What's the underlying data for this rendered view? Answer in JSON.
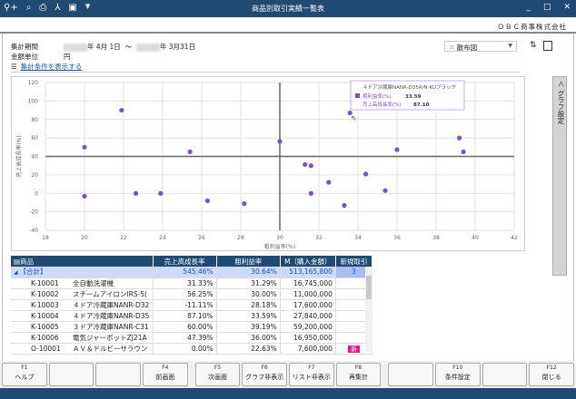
{
  "window": {
    "title": "商品別取引実績一覧表",
    "toolbar_icons": [
      "zoom-in-icon",
      "search-doc-icon",
      "print-icon",
      "pdf-icon",
      "excel-icon",
      "dropdown-icon"
    ]
  },
  "company": "ＯＢＣ商事株式会社",
  "conditions": {
    "period_label": "集計期間",
    "period_start": "年 4月 1日",
    "period_sep": "～",
    "period_end": "年 3月31日",
    "unit_label": "金額単位",
    "unit_value": "円",
    "show_conditions_link": "集計条件を表示する"
  },
  "chart_type_select": "散布図",
  "side_panel": "グラフ設定",
  "chart_data": {
    "type": "scatter",
    "xlabel": "粗利益率(%)",
    "ylabel": "売上高成長率(%)",
    "xlim": [
      18,
      42
    ],
    "ylim": [
      -40,
      120
    ],
    "xticks": [
      18,
      20,
      22,
      24,
      26,
      28,
      30,
      32,
      34,
      36,
      38,
      40,
      42
    ],
    "yticks": [
      -40,
      -20,
      0,
      20,
      40,
      60,
      80,
      100,
      120
    ],
    "grid": true,
    "quadrant_lines": {
      "x": 30,
      "y": 40
    },
    "color": "#7e4fc6",
    "points": [
      {
        "x": 20,
        "y": 50
      },
      {
        "x": 20,
        "y": -3
      },
      {
        "x": 21.9,
        "y": 90
      },
      {
        "x": 22.63,
        "y": 0
      },
      {
        "x": 23.9,
        "y": 0
      },
      {
        "x": 25.4,
        "y": 45
      },
      {
        "x": 26.3,
        "y": -8
      },
      {
        "x": 28.18,
        "y": -11.11
      },
      {
        "x": 30.0,
        "y": 56.25
      },
      {
        "x": 31.29,
        "y": 31.33
      },
      {
        "x": 31.6,
        "y": 30
      },
      {
        "x": 31.6,
        "y": 0
      },
      {
        "x": 32.5,
        "y": 12
      },
      {
        "x": 33.3,
        "y": -13
      },
      {
        "x": 33.59,
        "y": 87.1
      },
      {
        "x": 34.4,
        "y": 21
      },
      {
        "x": 35.4,
        "y": 3
      },
      {
        "x": 36.0,
        "y": 47.39
      },
      {
        "x": 39.19,
        "y": 60.0
      },
      {
        "x": 39.4,
        "y": 45
      }
    ],
    "tooltip": {
      "title": "４ドア冷蔵庫NANR-D35A/N-KUブラック",
      "x_label": "粗利益率(%)",
      "x_value": "33.59",
      "y_label": "売上高成長率(%)",
      "y_value": "87.10"
    }
  },
  "table": {
    "headers": [
      "商品",
      "売上高成長率",
      "粗利益率",
      "M（購入金額）",
      "新規取引"
    ],
    "total": {
      "label": "【合計】",
      "growth": "545.46%",
      "margin": "30.64%",
      "amount": "513,165,800",
      "new": "3"
    },
    "rows": [
      {
        "code": "K-10001",
        "name": "全自動洗濯機",
        "growth": "31.33%",
        "margin": "31.29%",
        "amount": "16,745,000",
        "new": ""
      },
      {
        "code": "K-10002",
        "name": "スチームアイロンIRS-5(",
        "growth": "56.25%",
        "margin": "30.00%",
        "amount": "11,000,000",
        "new": ""
      },
      {
        "code": "K-10003",
        "name": "４ドア冷蔵庫NANR-D32",
        "growth": "-11.11%",
        "margin": "28.18%",
        "amount": "17,600,000",
        "new": ""
      },
      {
        "code": "K-10004",
        "name": "４ドア冷蔵庫NANR-D35",
        "growth": "87.10%",
        "margin": "33.59%",
        "amount": "27,840,000",
        "new": ""
      },
      {
        "code": "K-10005",
        "name": "３ドア冷蔵庫NANR-C31",
        "growth": "60.00%",
        "margin": "39.19%",
        "amount": "59,200,000",
        "new": ""
      },
      {
        "code": "K-10006",
        "name": "電気ジャーポットZJ21A",
        "growth": "47.39%",
        "margin": "36.00%",
        "amount": "16,950,000",
        "new": ""
      },
      {
        "code": "O-10001",
        "name": "ＡＶ＆ドルビーサラウン",
        "growth": "0.00%",
        "margin": "22.63%",
        "amount": "7,600,000",
        "new": "新"
      }
    ]
  },
  "fkeys": [
    {
      "key": "F1",
      "label": "ヘルプ"
    },
    {
      "key": "",
      "label": ""
    },
    {
      "key": "",
      "label": ""
    },
    {
      "key": "F4",
      "label": "前画面"
    },
    {
      "key": "F5",
      "label": "次画面"
    },
    {
      "key": "F6",
      "label": "グラフ非表示"
    },
    {
      "key": "F7",
      "label": "リスト非表示"
    },
    {
      "key": "F8",
      "label": "再集計"
    },
    {
      "key": "",
      "label": ""
    },
    {
      "key": "F10",
      "label": "条件設定"
    },
    {
      "key": "",
      "label": ""
    },
    {
      "key": "F12",
      "label": "閉じる"
    }
  ]
}
